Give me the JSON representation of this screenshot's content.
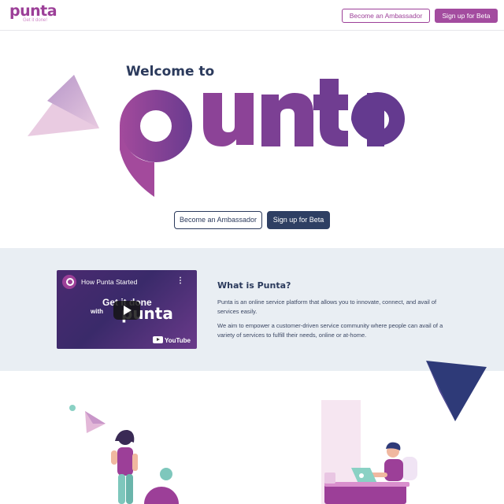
{
  "header": {
    "logo_text": "punta",
    "logo_tagline": "Get it done!",
    "ambassador_button": "Become an Ambassador",
    "signup_button": "Sign up for Beta"
  },
  "hero": {
    "welcome": "Welcome to",
    "brand": "punta",
    "ambassador_button": "Become an Ambassador",
    "signup_button": "Sign up for Beta"
  },
  "about": {
    "video": {
      "title": "How Punta Started",
      "overlay_line1": "Get it done",
      "overlay_line2": "with",
      "overlay_brand": "punta",
      "provider": "YouTube"
    },
    "heading": "What is Punta?",
    "paragraph1": "Punta is an online service platform that allows you to innovate, connect, and avail of services easily.",
    "paragraph2": "We aim to empower a customer-driven service community where people can avail of a variety of services to fulfill their needs, online or at-home."
  },
  "colors": {
    "brand_purple": "#9c3f98",
    "navy": "#2b3a5c",
    "section_bg": "#e9eef3"
  }
}
